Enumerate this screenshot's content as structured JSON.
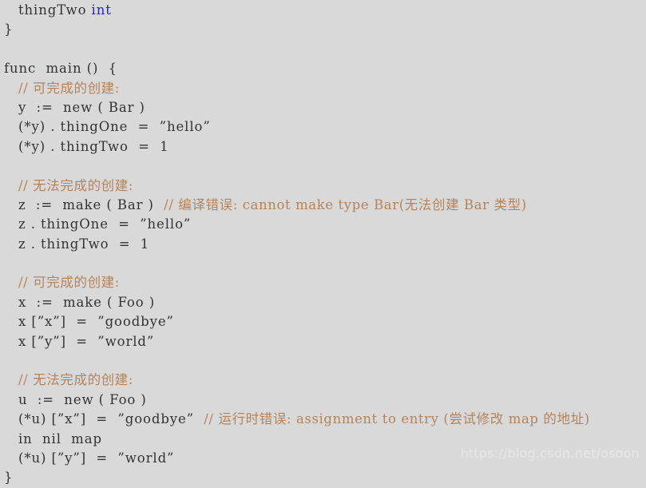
{
  "editor": {
    "language": "go",
    "background_color": "#d9d9d9",
    "text_color": "#333333",
    "comment_color": "#b5835a",
    "keyword_color": "#2222dd",
    "watermark_color": "#e7e7e7"
  },
  "watermark": {
    "text": "https://blog.csdn.net/osoon"
  },
  "code": {
    "lines": [
      {
        "indent": 1,
        "segments": [
          {
            "type": "plain",
            "text": "thingTwo "
          },
          {
            "type": "keyword",
            "text": "int"
          }
        ]
      },
      {
        "indent": 0,
        "segments": [
          {
            "type": "plain",
            "text": "}"
          }
        ]
      },
      {
        "indent": 0,
        "segments": []
      },
      {
        "indent": 0,
        "segments": [
          {
            "type": "plain",
            "text": "func  main ()  {"
          }
        ]
      },
      {
        "indent": 1,
        "segments": [
          {
            "type": "comment",
            "text": "// 可完成的创建:"
          }
        ]
      },
      {
        "indent": 1,
        "segments": [
          {
            "type": "plain",
            "text": "y  :=  new ( Bar )"
          }
        ]
      },
      {
        "indent": 1,
        "segments": [
          {
            "type": "plain",
            "text": "(*y) . thingOne  =  "
          },
          {
            "type": "string",
            "text": "”hello”"
          }
        ]
      },
      {
        "indent": 1,
        "segments": [
          {
            "type": "plain",
            "text": "(*y) . thingTwo  =  1"
          }
        ]
      },
      {
        "indent": 0,
        "segments": []
      },
      {
        "indent": 1,
        "segments": [
          {
            "type": "comment",
            "text": "// 无法完成的创建:"
          }
        ]
      },
      {
        "indent": 1,
        "segments": [
          {
            "type": "plain",
            "text": "z  :=  make ( Bar )  "
          },
          {
            "type": "comment",
            "text": "// 编译错误: cannot make type Bar(无法创建 Bar 类型)"
          }
        ]
      },
      {
        "indent": 1,
        "segments": [
          {
            "type": "plain",
            "text": "z . thingOne  =  "
          },
          {
            "type": "string",
            "text": "”hello”"
          }
        ]
      },
      {
        "indent": 1,
        "segments": [
          {
            "type": "plain",
            "text": "z . thingTwo  =  1"
          }
        ]
      },
      {
        "indent": 0,
        "segments": []
      },
      {
        "indent": 1,
        "segments": [
          {
            "type": "comment",
            "text": "// 可完成的创建:"
          }
        ]
      },
      {
        "indent": 1,
        "segments": [
          {
            "type": "plain",
            "text": "x  :=  make ( Foo )"
          }
        ]
      },
      {
        "indent": 1,
        "segments": [
          {
            "type": "plain",
            "text": "x ["
          },
          {
            "type": "string",
            "text": "”x”"
          },
          {
            "type": "plain",
            "text": "]  =  "
          },
          {
            "type": "string",
            "text": "”goodbye”"
          }
        ]
      },
      {
        "indent": 1,
        "segments": [
          {
            "type": "plain",
            "text": "x ["
          },
          {
            "type": "string",
            "text": "”y”"
          },
          {
            "type": "plain",
            "text": "]  =  "
          },
          {
            "type": "string",
            "text": "”world”"
          }
        ]
      },
      {
        "indent": 0,
        "segments": []
      },
      {
        "indent": 1,
        "segments": [
          {
            "type": "comment",
            "text": "// 无法完成的创建:"
          }
        ]
      },
      {
        "indent": 1,
        "segments": [
          {
            "type": "plain",
            "text": "u  :=  new ( Foo )"
          }
        ]
      },
      {
        "indent": 1,
        "segments": [
          {
            "type": "plain",
            "text": "(*u) ["
          },
          {
            "type": "string",
            "text": "”x”"
          },
          {
            "type": "plain",
            "text": "]  =  "
          },
          {
            "type": "string",
            "text": "”goodbye”"
          },
          {
            "type": "plain",
            "text": "  "
          },
          {
            "type": "comment",
            "text": "// 运行时错误: assignment to entry (尝试修改 map 的地址)"
          }
        ]
      },
      {
        "indent": 1,
        "segments": [
          {
            "type": "plain",
            "text": "in  nil  map"
          }
        ]
      },
      {
        "indent": 1,
        "segments": [
          {
            "type": "plain",
            "text": "(*u) ["
          },
          {
            "type": "string",
            "text": "”y”"
          },
          {
            "type": "plain",
            "text": "]  =  "
          },
          {
            "type": "string",
            "text": "”world”"
          }
        ]
      },
      {
        "indent": 0,
        "segments": [
          {
            "type": "plain",
            "text": "}"
          }
        ]
      }
    ]
  }
}
